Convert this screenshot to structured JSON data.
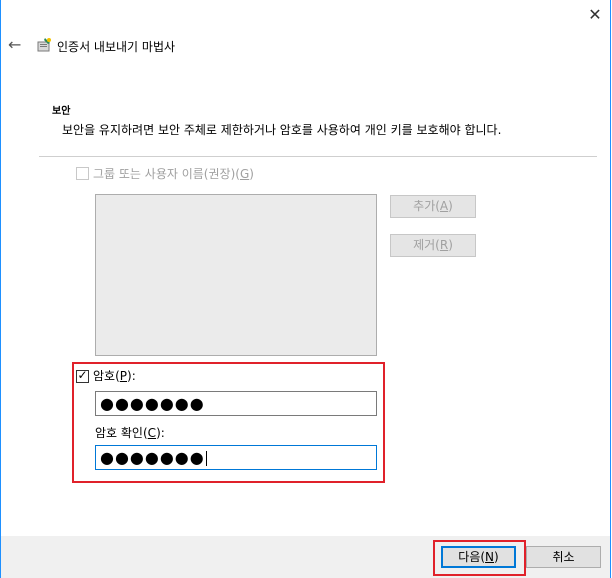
{
  "window": {
    "close_glyph": "✕"
  },
  "header": {
    "back_glyph": "←",
    "title": "인증서 내보내기 마법사"
  },
  "section": {
    "heading": "보안",
    "description": "보안을 유지하려면 보안 주체로 제한하거나 암호를 사용하여 개인 키를 보호해야 합니다."
  },
  "group_option": {
    "label_before": "그룹 또는 사용자 이름(권장)(",
    "accel": "G",
    "label_after": ")",
    "checked": false,
    "enabled": false
  },
  "buttons": {
    "add": {
      "before": "추가(",
      "accel": "A",
      "after": ")"
    },
    "remove": {
      "before": "제거(",
      "accel": "R",
      "after": ")"
    },
    "next": {
      "before": "다음(",
      "accel": "N",
      "after": ")"
    },
    "cancel": "취소"
  },
  "password": {
    "check_glyph": "✓",
    "checked": true,
    "label_before": "암호(",
    "accel": "P",
    "label_after": "):",
    "value": "●●●●●●●",
    "confirm_label_before": "암호 확인(",
    "confirm_accel": "C",
    "confirm_label_after": "):",
    "confirm_value": "●●●●●●●"
  },
  "colors": {
    "highlight": "#e0212a",
    "focus": "#0078d7"
  }
}
